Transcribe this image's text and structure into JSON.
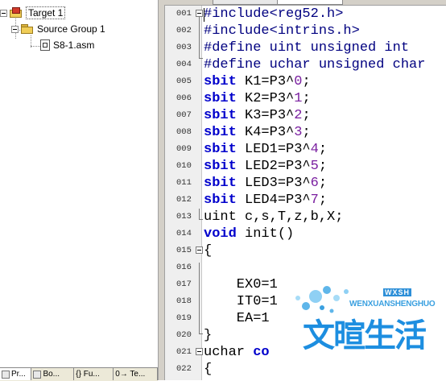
{
  "project_tree": {
    "target": "Target 1",
    "group": "Source Group 1",
    "file": "S8-1.asm"
  },
  "bottom_tabs": [
    {
      "label": "Pr..."
    },
    {
      "label": "Bo..."
    },
    {
      "label": "{} Fu..."
    },
    {
      "label": "0→ Te..."
    }
  ],
  "editor": {
    "lines": [
      {
        "num": "001",
        "segments": [
          {
            "text": "#include<reg52.h>",
            "cls": "pre"
          }
        ]
      },
      {
        "num": "002",
        "segments": [
          {
            "text": "#include<intrins.h>",
            "cls": "pre"
          }
        ]
      },
      {
        "num": "003",
        "segments": [
          {
            "text": "#define uint unsigned int",
            "cls": "pre"
          }
        ]
      },
      {
        "num": "004",
        "segments": [
          {
            "text": "#define uchar unsigned char",
            "cls": "pre"
          }
        ]
      },
      {
        "num": "005",
        "segments": [
          {
            "text": "sbit",
            "cls": "kw"
          },
          {
            "text": " K1=P3^",
            "cls": ""
          },
          {
            "text": "0",
            "cls": "num"
          },
          {
            "text": ";",
            "cls": ""
          }
        ]
      },
      {
        "num": "006",
        "segments": [
          {
            "text": "sbit",
            "cls": "kw"
          },
          {
            "text": " K2=P3^",
            "cls": ""
          },
          {
            "text": "1",
            "cls": "num"
          },
          {
            "text": ";",
            "cls": ""
          }
        ]
      },
      {
        "num": "007",
        "segments": [
          {
            "text": "sbit",
            "cls": "kw"
          },
          {
            "text": " K3=P3^",
            "cls": ""
          },
          {
            "text": "2",
            "cls": "num"
          },
          {
            "text": ";",
            "cls": ""
          }
        ]
      },
      {
        "num": "008",
        "segments": [
          {
            "text": "sbit",
            "cls": "kw"
          },
          {
            "text": " K4=P3^",
            "cls": ""
          },
          {
            "text": "3",
            "cls": "num"
          },
          {
            "text": ";",
            "cls": ""
          }
        ]
      },
      {
        "num": "009",
        "segments": [
          {
            "text": "sbit",
            "cls": "kw"
          },
          {
            "text": " LED1=P3^",
            "cls": ""
          },
          {
            "text": "4",
            "cls": "num"
          },
          {
            "text": ";",
            "cls": ""
          }
        ]
      },
      {
        "num": "010",
        "segments": [
          {
            "text": "sbit",
            "cls": "kw"
          },
          {
            "text": " LED2=P3^",
            "cls": ""
          },
          {
            "text": "5",
            "cls": "num"
          },
          {
            "text": ";",
            "cls": ""
          }
        ]
      },
      {
        "num": "011",
        "segments": [
          {
            "text": "sbit",
            "cls": "kw"
          },
          {
            "text": " LED3=P3^",
            "cls": ""
          },
          {
            "text": "6",
            "cls": "num"
          },
          {
            "text": ";",
            "cls": ""
          }
        ]
      },
      {
        "num": "012",
        "segments": [
          {
            "text": "sbit",
            "cls": "kw"
          },
          {
            "text": " LED4=P3^",
            "cls": ""
          },
          {
            "text": "7",
            "cls": "num"
          },
          {
            "text": ";",
            "cls": ""
          }
        ]
      },
      {
        "num": "013",
        "segments": [
          {
            "text": "uint c,s,T,z,b,X;",
            "cls": ""
          }
        ]
      },
      {
        "num": "014",
        "segments": [
          {
            "text": "void",
            "cls": "kw"
          },
          {
            "text": " init()",
            "cls": ""
          }
        ]
      },
      {
        "num": "015",
        "segments": [
          {
            "text": "{",
            "cls": ""
          }
        ]
      },
      {
        "num": "016",
        "segments": []
      },
      {
        "num": "017",
        "segments": [
          {
            "text": "    EX0=1",
            "cls": ""
          }
        ]
      },
      {
        "num": "018",
        "segments": [
          {
            "text": "    IT0=1",
            "cls": ""
          }
        ]
      },
      {
        "num": "019",
        "segments": [
          {
            "text": "    EA=1",
            "cls": ""
          }
        ]
      },
      {
        "num": "020",
        "segments": [
          {
            "text": "}",
            "cls": ""
          }
        ]
      },
      {
        "num": "021",
        "segments": [
          {
            "text": "uchar ",
            "cls": ""
          },
          {
            "text": "co",
            "cls": "kw"
          }
        ]
      },
      {
        "num": "022",
        "segments": [
          {
            "text": "{",
            "cls": ""
          }
        ]
      }
    ]
  },
  "watermark": {
    "main": "文暄生活",
    "sub": "WENXUANSHENGHUO",
    "badge": "WXSH"
  },
  "colors": {
    "keyword": "#0000cc",
    "preprocessor": "#000080",
    "number": "#7a1fa0",
    "watermark": "#1d8ee0"
  }
}
